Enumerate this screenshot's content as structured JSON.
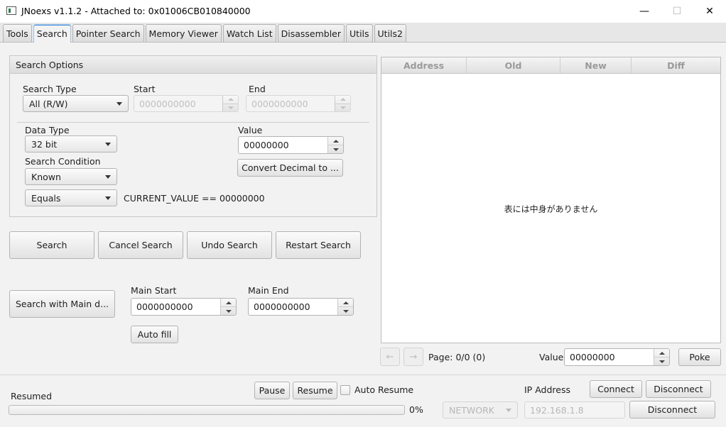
{
  "window": {
    "title": "JNoexs v1.1.2 - Attached to: 0x01006CB010840000",
    "minimize": "—",
    "maximize": "☐",
    "close": "✕"
  },
  "tabs": [
    {
      "label": "Tools"
    },
    {
      "label": "Search"
    },
    {
      "label": "Pointer Search"
    },
    {
      "label": "Memory Viewer"
    },
    {
      "label": "Watch List"
    },
    {
      "label": "Disassembler"
    },
    {
      "label": "Utils"
    },
    {
      "label": "Utils2"
    }
  ],
  "active_tab": "Search",
  "search_options": {
    "title": "Search Options",
    "search_type_label": "Search Type",
    "search_type_value": "All (R/W)",
    "start_label": "Start",
    "start_value": "0000000000",
    "end_label": "End",
    "end_value": "0000000000",
    "data_type_label": "Data Type",
    "data_type_value": "32 bit",
    "value_label": "Value",
    "value_value": "00000000",
    "convert_button": "Convert Decimal to ...",
    "search_condition_label": "Search Condition",
    "search_condition_value": "Known",
    "comparison_value": "Equals",
    "expression": "CURRENT_VALUE == 00000000"
  },
  "actions": {
    "search": "Search",
    "cancel_search": "Cancel Search",
    "undo_search": "Undo Search",
    "restart_search": "Restart Search"
  },
  "main_search": {
    "button": "Search with Main d...",
    "main_start_label": "Main Start",
    "main_start_value": "0000000000",
    "main_end_label": "Main End",
    "main_end_value": "0000000000",
    "auto_fill": "Auto fill"
  },
  "results_table": {
    "columns": [
      "Address",
      "Old",
      "New",
      "Diff"
    ],
    "empty_message": "表には中身がありません"
  },
  "pagination": {
    "prev": "←",
    "next": "→",
    "page_text": "Page: 0/0 (0)",
    "value_label": "Value",
    "value_value": "00000000",
    "poke": "Poke"
  },
  "status": {
    "text": "Resumed",
    "progress": 0,
    "progress_text": "0%",
    "pause": "Pause",
    "resume": "Resume",
    "auto_resume": "Auto Resume",
    "auto_resume_checked": false
  },
  "connection": {
    "ip_label": "IP Address",
    "connect": "Connect",
    "disconnect_top": "Disconnect",
    "mode_value": "NETWORK",
    "ip_value": "192.168.1.8",
    "disconnect_bottom": "Disconnect"
  },
  "colors": {
    "accent": "#3c8ede",
    "background": "#f2f2f2",
    "table_header_text": "#9a9a9a"
  }
}
